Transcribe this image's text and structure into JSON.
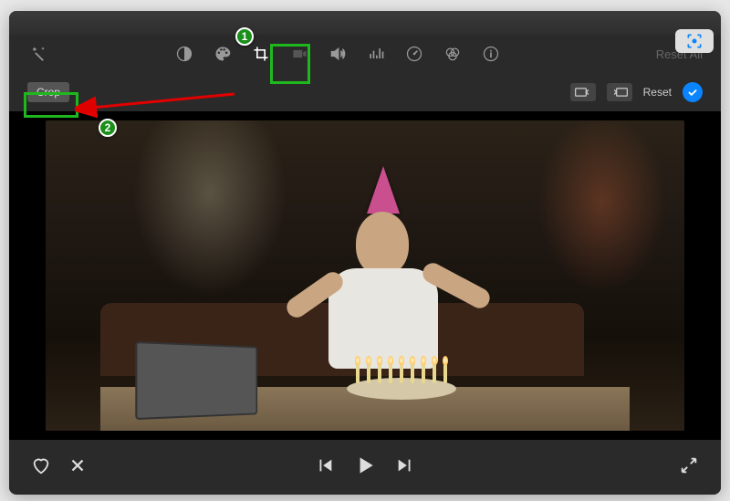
{
  "toolbar": {
    "reset_all_label": "Reset All"
  },
  "subtoolbar": {
    "crop_label": "Crop",
    "reset_label": "Reset"
  },
  "icons": {
    "magic_wand": "magic-wand-icon",
    "color_balance": "color-balance-icon",
    "color_palette": "color-palette-icon",
    "crop": "crop-icon",
    "camera": "camera-icon",
    "volume": "volume-icon",
    "equalizer": "equalizer-icon",
    "speed": "speed-icon",
    "color_filter": "color-filter-icon",
    "info": "info-icon",
    "rotate_ccw": "rotate-ccw-icon",
    "rotate_cw": "rotate-cw-icon",
    "apply_check": "checkmark-icon",
    "favorite": "heart-icon",
    "reject": "x-icon",
    "prev": "skip-back-icon",
    "play": "play-icon",
    "next": "skip-forward-icon",
    "fullscreen": "fullscreen-icon",
    "capture": "screen-capture-icon"
  },
  "annotations": {
    "badge1": "1",
    "badge2": "2"
  }
}
